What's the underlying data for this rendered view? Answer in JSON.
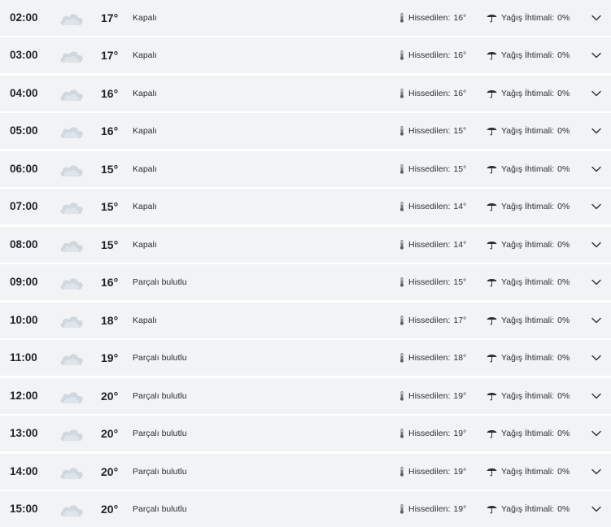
{
  "hourly": {
    "feels_label": "Hissedilen:",
    "rain_label": "Yağış İhtimali:",
    "icons": {
      "weather": "cloud-icon",
      "feels": "thermometer-icon",
      "rain": "umbrella-icon",
      "expand": "chevron-down-icon"
    },
    "colors": {
      "row_bg": "#f2f3f5",
      "cloud": "#cfd8df",
      "text": "#1f2329"
    },
    "rows": [
      {
        "time": "02:00",
        "temp": "17°",
        "condition": "Kapalı",
        "feels": "16°",
        "rain": "0%"
      },
      {
        "time": "03:00",
        "temp": "17°",
        "condition": "Kapalı",
        "feels": "16°",
        "rain": "0%"
      },
      {
        "time": "04:00",
        "temp": "16°",
        "condition": "Kapalı",
        "feels": "16°",
        "rain": "0%"
      },
      {
        "time": "05:00",
        "temp": "16°",
        "condition": "Kapalı",
        "feels": "15°",
        "rain": "0%"
      },
      {
        "time": "06:00",
        "temp": "15°",
        "condition": "Kapalı",
        "feels": "15°",
        "rain": "0%"
      },
      {
        "time": "07:00",
        "temp": "15°",
        "condition": "Kapalı",
        "feels": "14°",
        "rain": "0%"
      },
      {
        "time": "08:00",
        "temp": "15°",
        "condition": "Kapalı",
        "feels": "14°",
        "rain": "0%"
      },
      {
        "time": "09:00",
        "temp": "16°",
        "condition": "Parçalı bulutlu",
        "feels": "15°",
        "rain": "0%"
      },
      {
        "time": "10:00",
        "temp": "18°",
        "condition": "Kapalı",
        "feels": "17°",
        "rain": "0%"
      },
      {
        "time": "11:00",
        "temp": "19°",
        "condition": "Parçalı bulutlu",
        "feels": "18°",
        "rain": "0%"
      },
      {
        "time": "12:00",
        "temp": "20°",
        "condition": "Parçalı bulutlu",
        "feels": "19°",
        "rain": "0%"
      },
      {
        "time": "13:00",
        "temp": "20°",
        "condition": "Parçalı bulutlu",
        "feels": "19°",
        "rain": "0%"
      },
      {
        "time": "14:00",
        "temp": "20°",
        "condition": "Parçalı bulutlu",
        "feels": "19°",
        "rain": "0%"
      },
      {
        "time": "15:00",
        "temp": "20°",
        "condition": "Parçalı bulutlu",
        "feels": "19°",
        "rain": "0%"
      }
    ]
  }
}
